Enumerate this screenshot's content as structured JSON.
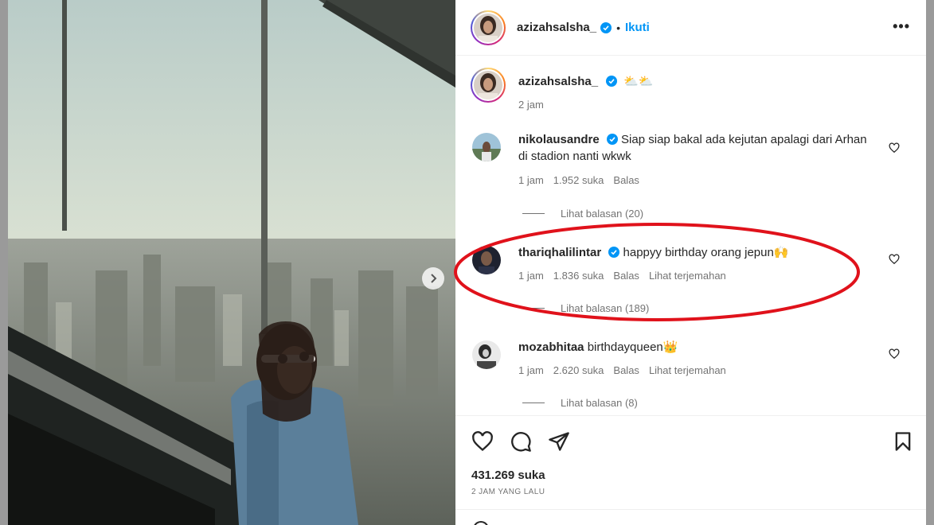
{
  "post": {
    "username": "azizahsalsha_",
    "follow_label": "Ikuti",
    "separator": "•",
    "more_label": "•••"
  },
  "caption": {
    "username": "azizahsalsha_",
    "text": "⛅⛅",
    "time": "2 jam"
  },
  "comments": [
    {
      "username": "nikolausandre",
      "text": "Siap siap bakal ada kejutan apalagi dari Arhan di stadion nanti wkwk",
      "time": "1 jam",
      "likes": "1.952 suka",
      "reply_label": "Balas",
      "translate_label": "",
      "view_replies": "Lihat balasan (20)"
    },
    {
      "username": "thariqhalilintar",
      "text": "happyy birthday orang jepun🙌",
      "time": "1 jam",
      "likes": "1.836 suka",
      "reply_label": "Balas",
      "translate_label": "Lihat terjemahan",
      "view_replies": "Lihat balasan (189)"
    },
    {
      "username": "mozabhitaa",
      "text": "birthdayqueen👑",
      "time": "1 jam",
      "likes": "2.620 suka",
      "reply_label": "Balas",
      "translate_label": "Lihat terjemahan",
      "view_replies": "Lihat balasan (8)"
    }
  ],
  "actions": {
    "likes": "431.269 suka",
    "posted": "2 JAM YANG LALU"
  },
  "colors": {
    "accent": "#0095f6",
    "verified": "#0095f6",
    "highlight": "#e0121b",
    "muted": "#737373"
  },
  "icons": {
    "verified": "verified-badge-icon",
    "like": "heart-icon",
    "comment": "comment-icon",
    "share": "paper-plane-icon",
    "save": "bookmark-icon",
    "next": "chevron-right-icon",
    "more": "more-options-icon"
  }
}
